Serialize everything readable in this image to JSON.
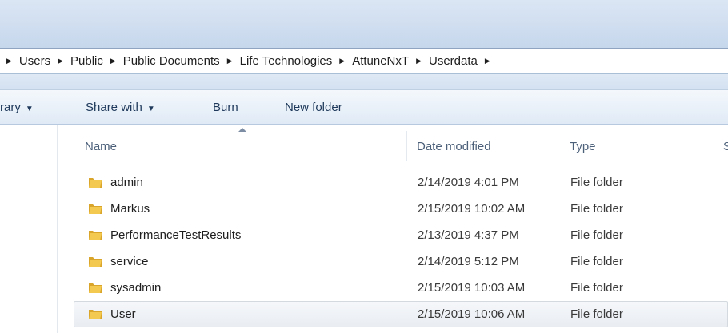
{
  "address": {
    "crumbs": [
      "Users",
      "Public",
      "Public Documents",
      "Life Technologies",
      "AttuneNxT",
      "Userdata"
    ]
  },
  "toolbar": {
    "library_partial": "rary",
    "share_with": "Share with",
    "burn": "Burn",
    "new_folder": "New folder"
  },
  "columns": {
    "name": "Name",
    "date_modified": "Date modified",
    "type": "Type",
    "size_partial": "S"
  },
  "icons": {
    "folder": "folder-icon",
    "breadcrumb_arrow": "chevron-right-icon",
    "dropdown": "chevron-down-icon"
  },
  "colors": {
    "folder_yellow": "#f3c94f",
    "folder_dark": "#d9a52a",
    "toolbar_text": "#1e395b"
  },
  "files": [
    {
      "name": "admin",
      "date": "2/14/2019 4:01 PM",
      "type": "File folder"
    },
    {
      "name": "Markus",
      "date": "2/15/2019 10:02 AM",
      "type": "File folder"
    },
    {
      "name": "PerformanceTestResults",
      "date": "2/13/2019 4:37 PM",
      "type": "File folder"
    },
    {
      "name": "service",
      "date": "2/14/2019 5:12 PM",
      "type": "File folder"
    },
    {
      "name": "sysadmin",
      "date": "2/15/2019 10:03 AM",
      "type": "File folder"
    },
    {
      "name": "User",
      "date": "2/15/2019 10:06 AM",
      "type": "File folder"
    }
  ]
}
